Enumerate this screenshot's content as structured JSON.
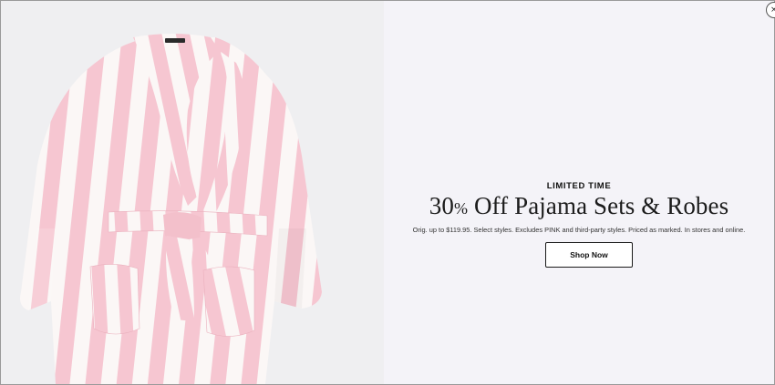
{
  "promo": {
    "eyebrow": "LIMITED TIME",
    "headline_number": "30",
    "headline_percent": "%",
    "headline_rest": " Off Pajama Sets & Robes",
    "disclaimer": "Orig. up to $119.95. Select styles. Excludes PINK and third-party styles. Priced as marked. In stores and online.",
    "cta_label": "Shop Now"
  },
  "close": {
    "icon": "close-icon",
    "glyph": "×"
  },
  "colors": {
    "panel_background": "#f4f3f8",
    "image_background": "#efeff1",
    "robe_pink": "#f6c6d1",
    "robe_white": "#fbf7f6",
    "text": "#111111",
    "cta_border": "#1a1a1a"
  },
  "image": {
    "subject": "pink-and-white-striped-robe"
  }
}
